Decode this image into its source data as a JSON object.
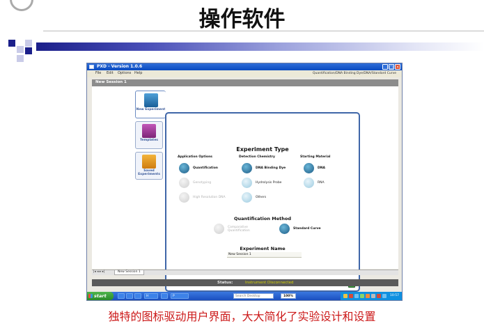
{
  "slide": {
    "title": "操作软件",
    "caption": "独特的图标驱动用户界面，大大简化了实验设计和设置"
  },
  "app": {
    "window_title": "PXD - Version 1.0.6",
    "menu": [
      "File",
      "Edit",
      "Options",
      "Help"
    ],
    "breadcrumb": "Quantification/DNA Binding Dye/DNA/Standard Curve",
    "session_title": "New Session 1",
    "side_tabs": [
      {
        "label": "New Experiment",
        "icon": "grid-icon"
      },
      {
        "label": "Templates",
        "icon": "template-icon"
      },
      {
        "label": "Saved Experiments",
        "icon": "search-folder-icon"
      }
    ],
    "experiment_type_title": "Experiment Type",
    "columns": {
      "application": {
        "header": "Application Options",
        "items": [
          {
            "label": "Quantification",
            "state": "selected"
          },
          {
            "label": "Genotyping",
            "state": "disabled"
          },
          {
            "label": "High Resolution DNA",
            "state": "disabled"
          }
        ]
      },
      "detection": {
        "header": "Detection Chemistry",
        "items": [
          {
            "label": "DNA Binding Dye",
            "state": "selected"
          },
          {
            "label": "Hydrolysis Probe",
            "state": "available"
          },
          {
            "label": "Others",
            "state": "available"
          }
        ]
      },
      "material": {
        "header": "Starting Material",
        "items": [
          {
            "label": "DNA",
            "state": "selected"
          },
          {
            "label": "RNA",
            "state": "available"
          }
        ]
      }
    },
    "quant_method": {
      "header": "Quantification Method",
      "items": [
        {
          "label": "Comparative Quantification",
          "state": "disabled"
        },
        {
          "label": "Standard Curve",
          "state": "selected"
        }
      ]
    },
    "experiment_name": {
      "header": "Experiment Name",
      "value": "New Session 1"
    },
    "doc_tab": "New Session 1",
    "status": {
      "label": "Status:",
      "value": "Instrument Disconnected"
    },
    "taskbar": {
      "start": "start",
      "items": [
        "",
        "",
        "",
        "H",
        "",
        "P"
      ],
      "search_placeholder": "Search Desktop",
      "zoom": "100%",
      "clock": "10:57"
    }
  },
  "colors": {
    "accent": "#3f66a8",
    "status_value": "#d7d400",
    "caption": "#cc1a1a"
  }
}
